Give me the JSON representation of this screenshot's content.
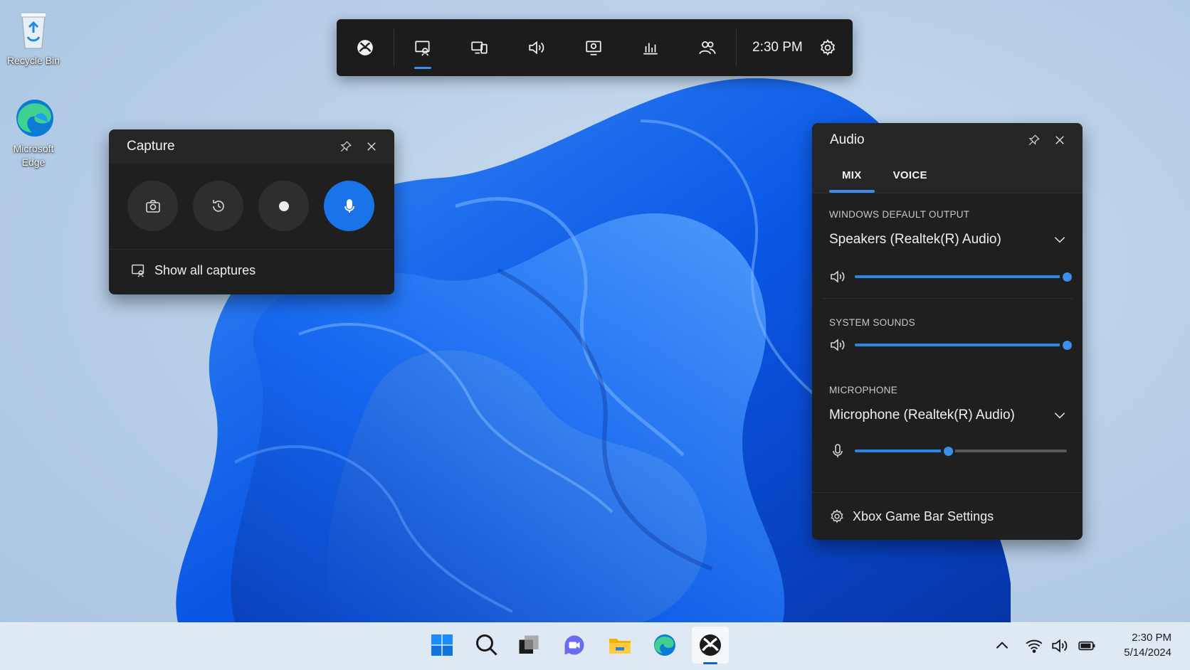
{
  "desktop": {
    "icons": [
      {
        "label": "Recycle Bin"
      },
      {
        "label_line1": "Microsoft",
        "label_line2": "Edge"
      }
    ]
  },
  "game_bar": {
    "time": "2:30 PM",
    "buttons": [
      "xbox-icon",
      "capture-widget-icon",
      "performance-widget-icon",
      "audio-widget-icon",
      "resources-widget-icon",
      "performance-chart-icon",
      "social-icon"
    ],
    "active": "capture-widget-icon"
  },
  "capture": {
    "title": "Capture",
    "buttons": [
      "screenshot",
      "record-last-30s",
      "start-recording",
      "microphone"
    ],
    "mic_on": true,
    "show_all": "Show all captures"
  },
  "audio": {
    "title": "Audio",
    "tabs": [
      {
        "label": "MIX",
        "active": true
      },
      {
        "label": "VOICE",
        "active": false
      }
    ],
    "output": {
      "label": "WINDOWS DEFAULT OUTPUT",
      "device": "Speakers (Realtek(R) Audio)",
      "volume": 1.0
    },
    "system_sounds": {
      "label": "SYSTEM SOUNDS",
      "volume": 1.0
    },
    "microphone": {
      "label": "MICROPHONE",
      "device": "Microphone (Realtek(R) Audio)",
      "volume": 0.44
    },
    "settings_label": "Xbox Game Bar Settings"
  },
  "taskbar": {
    "apps": [
      "start-icon",
      "search-icon",
      "task-view-icon",
      "chat-icon",
      "file-explorer-icon",
      "edge-icon",
      "xbox-icon"
    ],
    "active_app": "xbox-icon",
    "clock": {
      "time": "2:30 PM",
      "date": "5/14/2024"
    }
  },
  "colors": {
    "accent": "#3b8eea",
    "panel": "#1f1f1f",
    "bar": "#1c1c1c"
  }
}
